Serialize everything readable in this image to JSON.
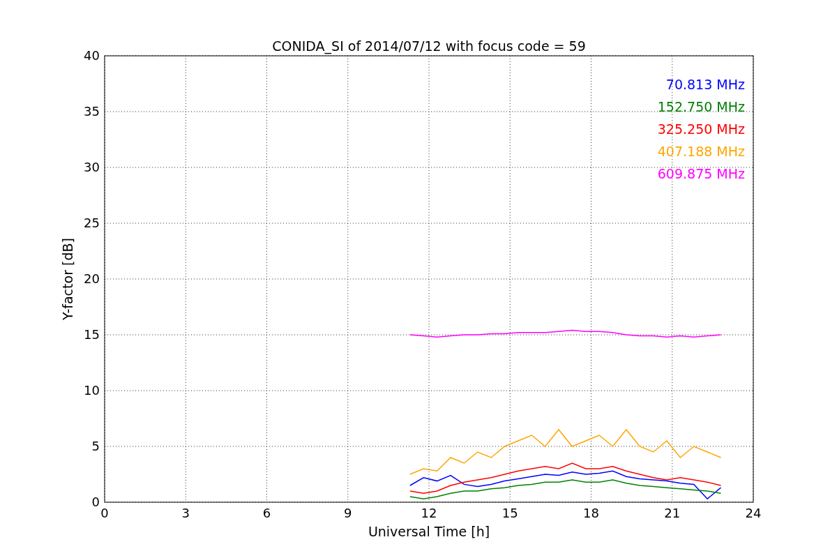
{
  "chart_data": {
    "type": "line",
    "title": "CONIDA_SI of 2014/07/12 with focus code = 59",
    "xlabel": "Universal Time [h]",
    "ylabel": "Y-factor [dB]",
    "x": [
      11.3,
      11.8,
      12.3,
      12.8,
      13.3,
      13.8,
      14.3,
      14.8,
      15.3,
      15.8,
      16.3,
      16.8,
      17.3,
      17.8,
      18.3,
      18.8,
      19.3,
      19.8,
      20.3,
      20.8,
      21.3,
      21.8,
      22.3,
      22.8
    ],
    "series": [
      {
        "name": "70.813 MHz",
        "color": "#0000ff",
        "values": [
          1.5,
          2.2,
          1.9,
          2.4,
          1.6,
          1.4,
          1.6,
          1.9,
          2.1,
          2.3,
          2.5,
          2.4,
          2.7,
          2.5,
          2.6,
          2.8,
          2.3,
          2.1,
          2,
          1.9,
          1.7,
          1.6,
          0.3,
          1.3
        ]
      },
      {
        "name": "152.750 MHz",
        "color": "#008000",
        "values": [
          0.5,
          0.3,
          0.5,
          0.8,
          1,
          1,
          1.2,
          1.3,
          1.5,
          1.6,
          1.8,
          1.8,
          2,
          1.8,
          1.8,
          2,
          1.7,
          1.5,
          1.4,
          1.3,
          1.2,
          1.1,
          1,
          0.8
        ]
      },
      {
        "name": "325.250 MHz",
        "color": "#ff0000",
        "values": [
          1,
          0.8,
          1,
          1.5,
          1.8,
          2,
          2.2,
          2.5,
          2.8,
          3,
          3.2,
          3,
          3.5,
          3,
          3,
          3.2,
          2.8,
          2.5,
          2.2,
          2,
          2.2,
          2,
          1.8,
          1.5
        ]
      },
      {
        "name": "407.188 MHz",
        "color": "#ffa500",
        "values": [
          2.5,
          3,
          2.8,
          4,
          3.5,
          4.5,
          4,
          5,
          5.5,
          6,
          5,
          6.5,
          5,
          5.5,
          6,
          5,
          6.5,
          5,
          4.5,
          5.5,
          4,
          5,
          4.5,
          4
        ]
      },
      {
        "name": "609.875 MHz",
        "color": "#ff00ff",
        "values": [
          15,
          14.9,
          14.8,
          14.9,
          15,
          15,
          15.1,
          15.1,
          15.2,
          15.2,
          15.2,
          15.3,
          15.4,
          15.3,
          15.3,
          15.2,
          15,
          14.9,
          14.9,
          14.8,
          14.9,
          14.8,
          14.9,
          15
        ]
      }
    ],
    "xlim": [
      0,
      24
    ],
    "ylim": [
      0,
      40
    ],
    "xticks": [
      0,
      3,
      6,
      9,
      12,
      15,
      18,
      21,
      24
    ],
    "yticks": [
      0,
      5,
      10,
      15,
      20,
      25,
      30,
      35,
      40
    ],
    "grid": true
  }
}
